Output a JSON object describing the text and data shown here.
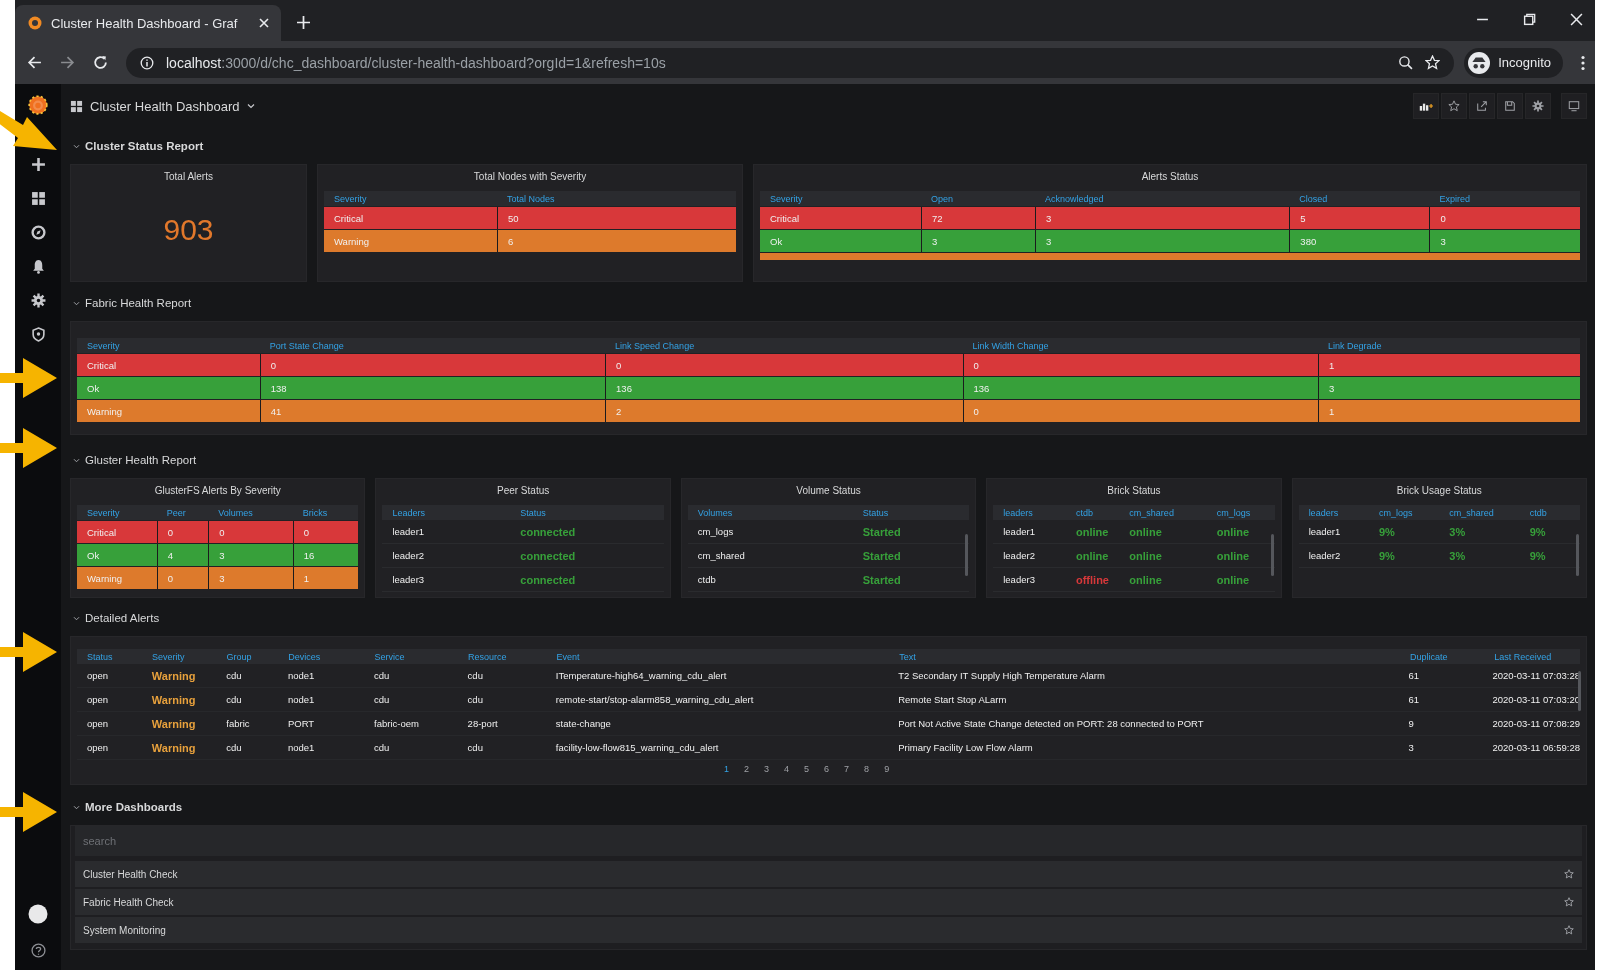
{
  "browser": {
    "tab_title": "Cluster Health Dashboard - Graf",
    "url_host": "localhost",
    "url_path": ":3000/d/chc_dashboard/cluster-health-dashboard?orgId=1&refresh=10s",
    "profile_label": "Incognito"
  },
  "dashboard": {
    "title": "Cluster Health Dashboard"
  },
  "cluster_status": {
    "title": "Cluster Status Report",
    "annotation_arrow": {
      "kind": "diagonal"
    },
    "total_alerts": {
      "title": "Total Alerts",
      "value": "903"
    },
    "nodes_table": {
      "title": "Total Nodes with Severity",
      "columns": [
        "Severity",
        "Total Nodes"
      ],
      "rows": [
        {
          "color": "#d8383a",
          "cells": [
            "Critical",
            "50"
          ]
        },
        {
          "color": "#dd7a2c",
          "cells": [
            "Warning",
            "6"
          ]
        }
      ]
    },
    "alerts_table": {
      "title": "Alerts Status",
      "columns": [
        "Severity",
        "Open",
        "Acknowledged",
        "Closed",
        "Expired"
      ],
      "rows": [
        {
          "color": "#d8383a",
          "cells": [
            "Critical",
            "72",
            "3",
            "5",
            "0"
          ]
        },
        {
          "color": "#37a03a",
          "cells": [
            "Ok",
            "3",
            "3",
            "380",
            "3"
          ]
        },
        {
          "color": "#dd7a2c",
          "clipped": true,
          "cells": []
        }
      ]
    }
  },
  "fabric": {
    "title": "Fabric Health Report",
    "annotation_arrow": {
      "kind": "horizontal"
    },
    "table": {
      "columns": [
        "Severity",
        "Port State Change",
        "Link Speed Change",
        "Link Width Change",
        "Link Degrade"
      ],
      "rows": [
        {
          "color": "#d8383a",
          "cells": [
            "Critical",
            "0",
            "0",
            "0",
            "1"
          ]
        },
        {
          "color": "#37a03a",
          "cells": [
            "Ok",
            "138",
            "136",
            "136",
            "3"
          ]
        },
        {
          "color": "#dd7a2c",
          "cells": [
            "Warning",
            "41",
            "2",
            "0",
            "1"
          ]
        }
      ]
    }
  },
  "gluster": {
    "title": "Gluster Health Report",
    "annotation_arrow": {
      "kind": "horizontal"
    },
    "panels": [
      {
        "title": "GlusterFS Alerts By Severity",
        "scrollbar": false,
        "columns": [
          "Severity",
          "Peer",
          "Volumes",
          "Bricks"
        ],
        "rows": [
          {
            "color": "#d8383a",
            "cells": [
              "Critical",
              "0",
              "0",
              "0"
            ]
          },
          {
            "color": "#37a03a",
            "cells": [
              "Ok",
              "4",
              "3",
              "16"
            ]
          },
          {
            "color": "#dd7a2c",
            "cells": [
              "Warning",
              "0",
              "3",
              "1"
            ]
          }
        ]
      },
      {
        "title": "Peer Status",
        "scrollbar": false,
        "columns": [
          "Leaders",
          "Status"
        ],
        "rows": [
          {
            "cells": [
              "leader1",
              {
                "text": "connected",
                "color": "#37a03a"
              }
            ]
          },
          {
            "cells": [
              "leader2",
              {
                "text": "connected",
                "color": "#37a03a"
              }
            ]
          },
          {
            "cells": [
              "leader3",
              {
                "text": "connected",
                "color": "#37a03a"
              }
            ]
          }
        ]
      },
      {
        "title": "Volume Status",
        "scrollbar": true,
        "columns": [
          "Volumes",
          "Status"
        ],
        "rows": [
          {
            "cells": [
              "cm_logs",
              {
                "text": "Started",
                "color": "#37a03a"
              }
            ]
          },
          {
            "cells": [
              "cm_shared",
              {
                "text": "Started",
                "color": "#37a03a"
              }
            ]
          },
          {
            "cells": [
              "ctdb",
              {
                "text": "Started",
                "color": "#37a03a"
              }
            ]
          }
        ]
      },
      {
        "title": "Brick Status",
        "scrollbar": true,
        "columns": [
          "leaders",
          "ctdb",
          "cm_shared",
          "cm_logs"
        ],
        "rows": [
          {
            "cells": [
              "leader1",
              {
                "text": "online",
                "color": "#37a03a"
              },
              {
                "text": "online",
                "color": "#37a03a"
              },
              {
                "text": "online",
                "color": "#37a03a"
              }
            ]
          },
          {
            "cells": [
              "leader2",
              {
                "text": "online",
                "color": "#37a03a"
              },
              {
                "text": "online",
                "color": "#37a03a"
              },
              {
                "text": "online",
                "color": "#37a03a"
              }
            ]
          },
          {
            "cells": [
              "leader3",
              {
                "text": "offline",
                "color": "#d8383a"
              },
              {
                "text": "online",
                "color": "#37a03a"
              },
              {
                "text": "online",
                "color": "#37a03a"
              }
            ]
          }
        ]
      },
      {
        "title": "Brick Usage Status",
        "scrollbar": true,
        "columns": [
          "leaders",
          "cm_logs",
          "cm_shared",
          "ctdb"
        ],
        "rows": [
          {
            "cells": [
              "leader1",
              {
                "text": "9%",
                "color": "#37a03a"
              },
              {
                "text": "3%",
                "color": "#37a03a"
              },
              {
                "text": "9%",
                "color": "#37a03a"
              }
            ]
          },
          {
            "cells": [
              "leader2",
              {
                "text": "9%",
                "color": "#37a03a"
              },
              {
                "text": "3%",
                "color": "#37a03a"
              },
              {
                "text": "9%",
                "color": "#37a03a"
              }
            ]
          }
        ]
      }
    ]
  },
  "alerts": {
    "title": "Detailed Alerts",
    "annotation_arrow": {
      "kind": "horizontal"
    },
    "columns": [
      "Status",
      "Severity",
      "Group",
      "Devices",
      "Service",
      "Resource",
      "Event",
      "Text",
      "Duplicate",
      "Last Received"
    ],
    "rows": [
      {
        "cells": [
          "open",
          {
            "text": "Warning",
            "color": "#e8a13c"
          },
          "cdu",
          "node1",
          "cdu",
          "cdu",
          "ITemperature-high64_warning_cdu_alert",
          "T2 Secondary IT Supply High Temperature Alarm",
          "61",
          "2020-03-11 07:03:28"
        ]
      },
      {
        "cells": [
          "open",
          {
            "text": "Warning",
            "color": "#e8a13c"
          },
          "cdu",
          "node1",
          "cdu",
          "cdu",
          "remote-start/stop-alarm858_warning_cdu_alert",
          "Remote Start Stop ALarm",
          "61",
          "2020-03-11 07:03:20"
        ]
      },
      {
        "cells": [
          "open",
          {
            "text": "Warning",
            "color": "#e8a13c"
          },
          "fabric",
          "PORT",
          "fabric-oem",
          "28-port",
          "state-change",
          "Port Not Active State Change detected on PORT: 28 connected to PORT",
          "9",
          "2020-03-11 07:08:29"
        ]
      },
      {
        "cells": [
          "open",
          {
            "text": "Warning",
            "color": "#e8a13c"
          },
          "cdu",
          "node1",
          "cdu",
          "cdu",
          "facility-low-flow815_warning_cdu_alert",
          "Primary Facility Low Flow Alarm",
          "3",
          "2020-03-11 06:59:28"
        ]
      }
    ],
    "pages": [
      {
        "label": "1",
        "selected": true
      },
      {
        "label": "2",
        "selected": false
      },
      {
        "label": "3",
        "selected": false
      },
      {
        "label": "4",
        "selected": false
      },
      {
        "label": "5",
        "selected": false
      },
      {
        "label": "6",
        "selected": false
      },
      {
        "label": "7",
        "selected": false
      },
      {
        "label": "8",
        "selected": false
      },
      {
        "label": "9",
        "selected": false
      }
    ]
  },
  "more": {
    "title": "More Dashboards",
    "annotation_arrow": {
      "kind": "horizontal"
    },
    "search": {
      "placeholder": "search"
    },
    "items": [
      {
        "label": "Cluster Health Check",
        "starred": false
      },
      {
        "label": "Fabric Health Check",
        "starred": false
      },
      {
        "label": "System Monitoring",
        "starred": false
      }
    ]
  }
}
